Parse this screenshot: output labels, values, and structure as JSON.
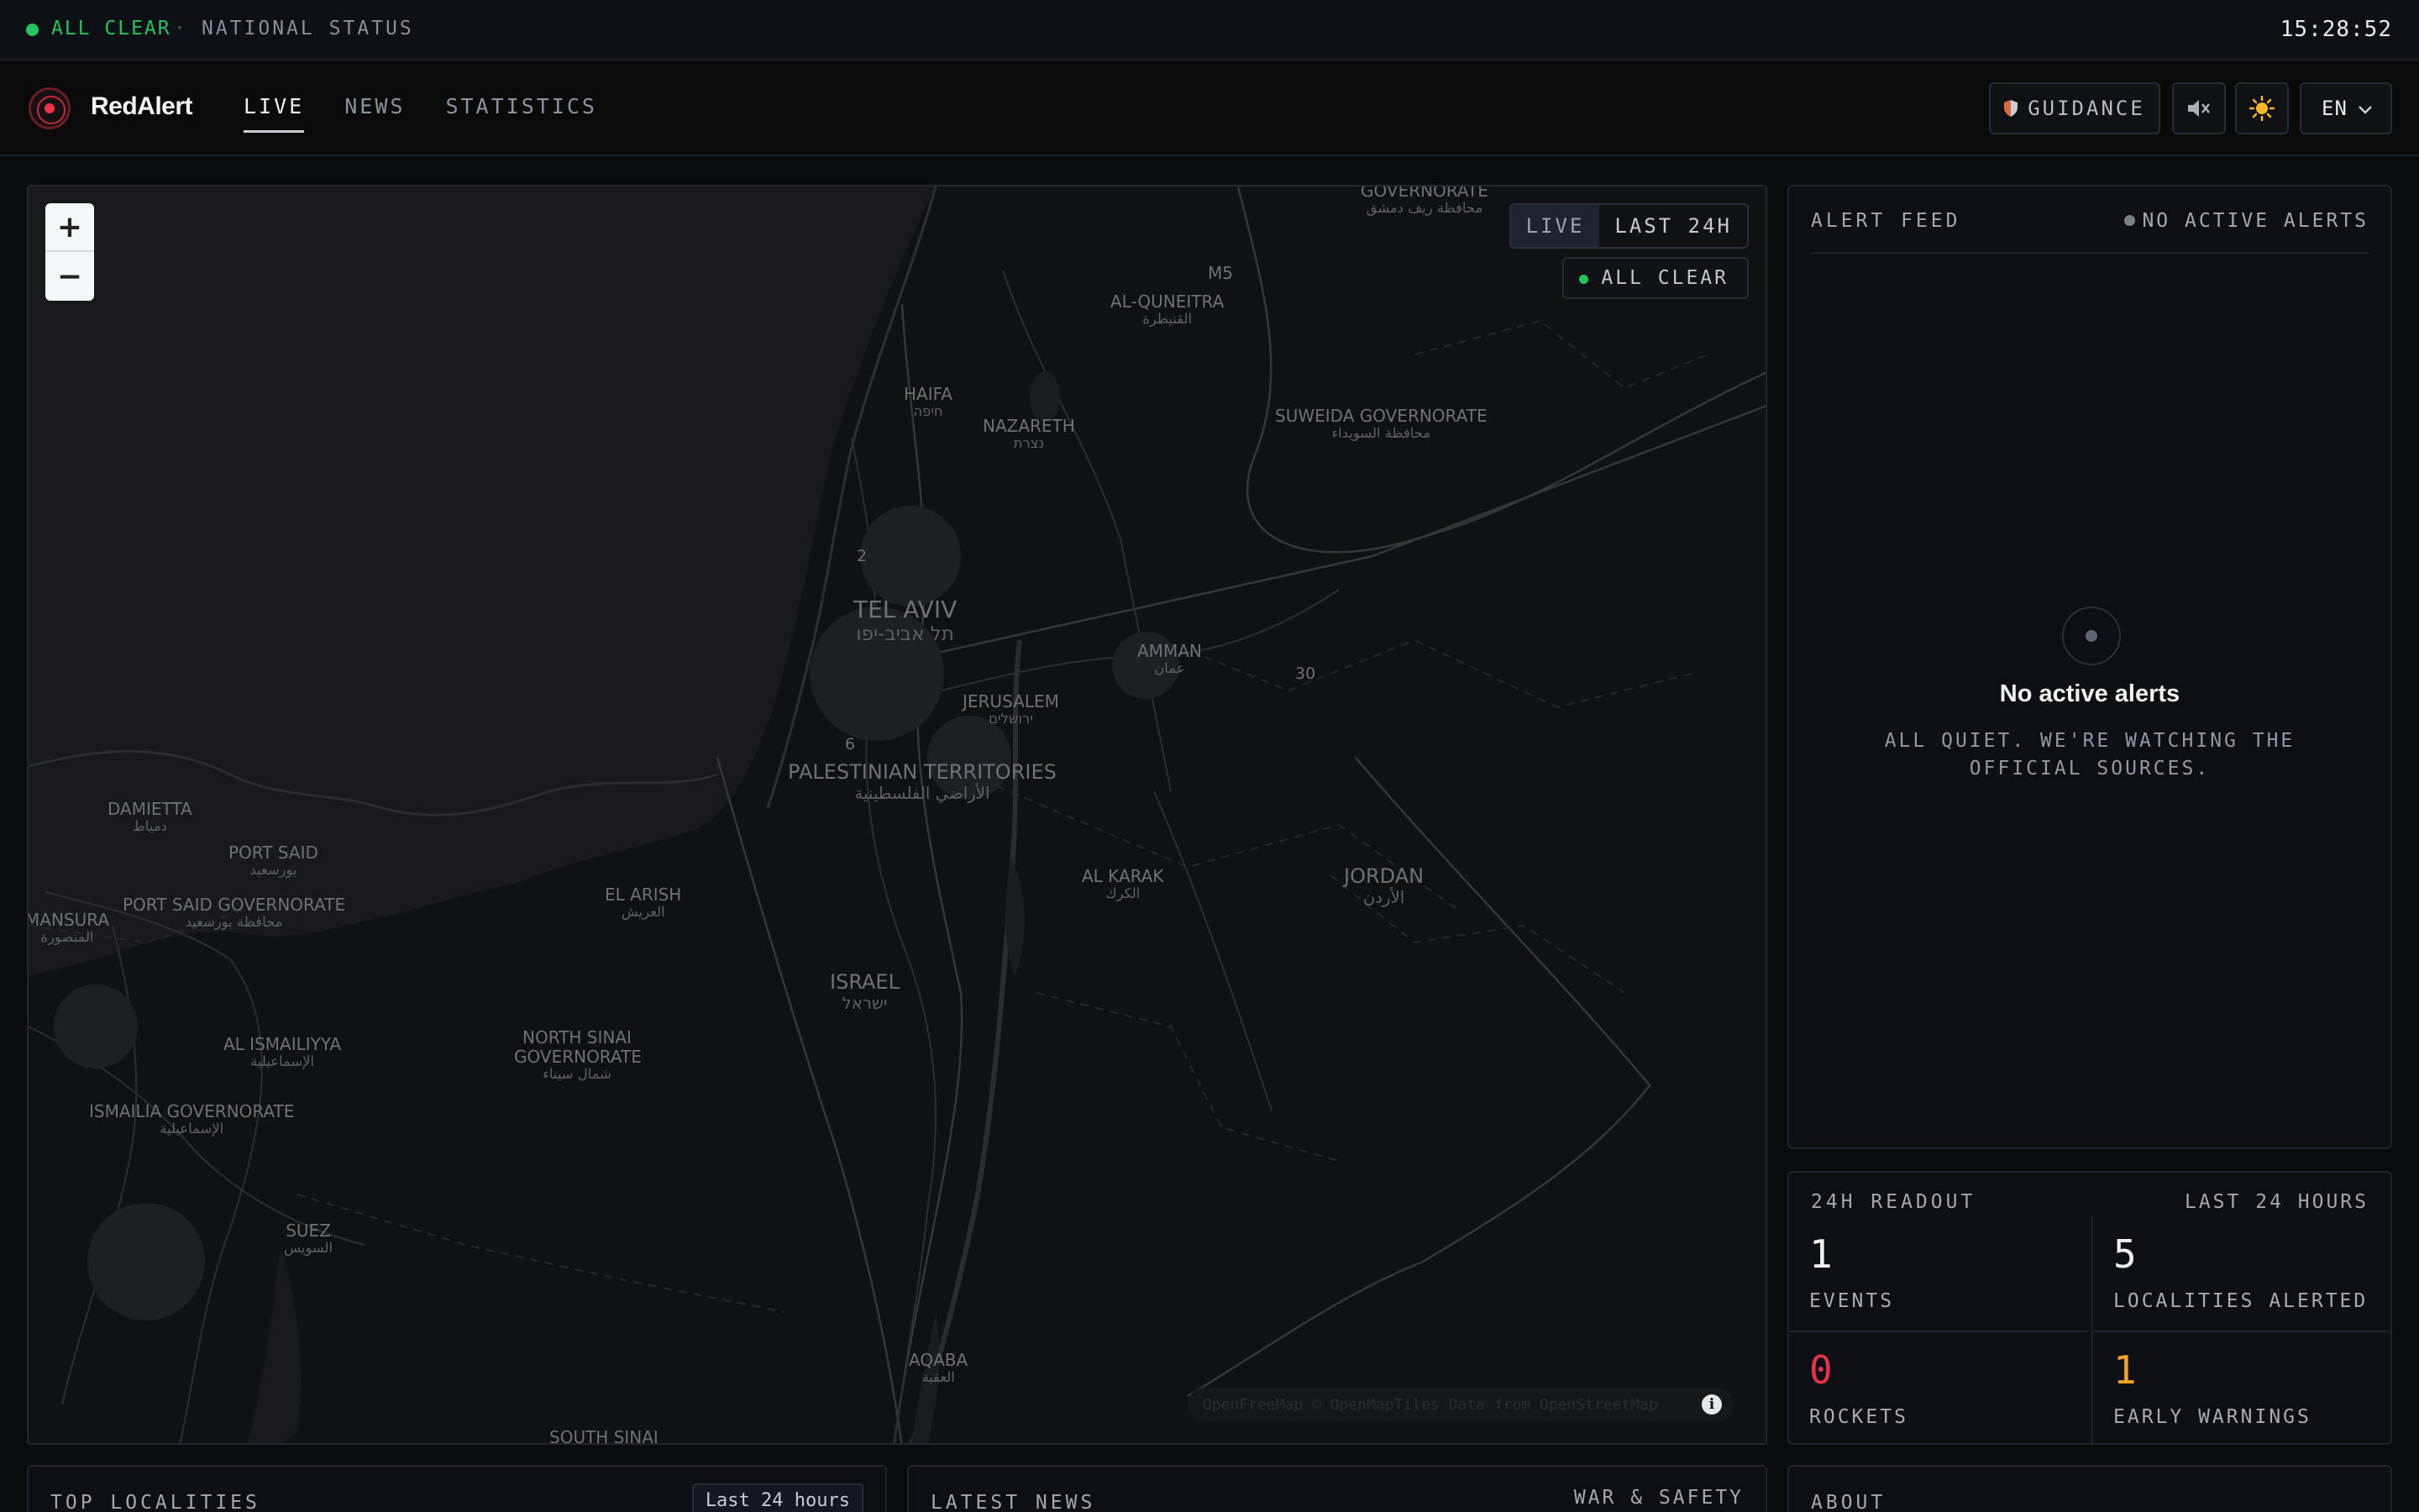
{
  "status_bar": {
    "state": "ALL CLEAR",
    "separator": "·",
    "label": "NATIONAL STATUS",
    "time": "15:28:52"
  },
  "header": {
    "brand": "RedAlert",
    "nav": [
      {
        "label": "LIVE",
        "active": true
      },
      {
        "label": "NEWS",
        "active": false
      },
      {
        "label": "STATISTICS",
        "active": false
      }
    ],
    "guidance_label": "GUIDANCE",
    "sound_icon": "speaker-muted-icon",
    "theme_icon": "sun-icon",
    "language": "EN"
  },
  "map": {
    "zoom_in": "+",
    "zoom_out": "−",
    "modes": [
      "LIVE",
      "LAST 24H"
    ],
    "active_mode": "LIVE",
    "badge": "ALL CLEAR",
    "attribution": "OpenFreeMap © OpenMapTiles Data from OpenStreetMap",
    "attribution_icon": "i",
    "labels": [
      {
        "id": "damascus-gov",
        "name": "GOVERNORATE",
        "native": "محافظة ريف دمشق"
      },
      {
        "id": "m5",
        "name": "M5",
        "native": ""
      },
      {
        "id": "quneitra",
        "name": "AL-QUNEITRA",
        "native": "القنيطرة"
      },
      {
        "id": "haifa",
        "name": "HAIFA",
        "native": "חיפה"
      },
      {
        "id": "nazareth",
        "name": "NAZARETH",
        "native": "נצרת"
      },
      {
        "id": "suweida",
        "name": "SUWEIDA GOVERNORATE",
        "native": "محافظة السويداء"
      },
      {
        "id": "tel-aviv",
        "name": "TEL AVIV",
        "native": "תל אביב-יפו"
      },
      {
        "id": "amman",
        "name": "AMMAN",
        "native": "عمان"
      },
      {
        "id": "r30",
        "name": "30",
        "native": ""
      },
      {
        "id": "jerusalem",
        "name": "JERUSALEM",
        "native": "ירושלים"
      },
      {
        "id": "r6",
        "name": "6",
        "native": ""
      },
      {
        "id": "r2",
        "name": "2",
        "native": ""
      },
      {
        "id": "palestine",
        "name": "PALESTINIAN TERRITORIES",
        "native": "الأراضي الفلسطينية"
      },
      {
        "id": "damietta",
        "name": "DAMIETTA",
        "native": "دمياط"
      },
      {
        "id": "port-said",
        "name": "PORT SAID",
        "native": "بورسعيد"
      },
      {
        "id": "port-said-gov",
        "name": "PORT SAID GOVERNORATE",
        "native": "محافظة بورسعيد"
      },
      {
        "id": "mansura",
        "name": "MANSURA",
        "native": "المنصورة"
      },
      {
        "id": "el-arish",
        "name": "EL ARISH",
        "native": "العريش"
      },
      {
        "id": "al-karak",
        "name": "AL KARAK",
        "native": "الكرك"
      },
      {
        "id": "jordan",
        "name": "JORDAN",
        "native": "الأردن"
      },
      {
        "id": "israel",
        "name": "ISRAEL",
        "native": "ישראל"
      },
      {
        "id": "north-sinai",
        "name": "NORTH SINAI GOVERNORATE",
        "native": "شمال سيناء"
      },
      {
        "id": "ismailiyya",
        "name": "AL ISMAILIYYA",
        "native": "الإسماعيلية"
      },
      {
        "id": "ismailia-gov",
        "name": "ISMAILIA GOVERNORATE",
        "native": "الإسماعيلية"
      },
      {
        "id": "suez",
        "name": "SUEZ",
        "native": "السويس"
      },
      {
        "id": "aqaba",
        "name": "AQABA",
        "native": "العقبة"
      },
      {
        "id": "south-sinai",
        "name": "SOUTH SINAI",
        "native": ""
      }
    ]
  },
  "feed": {
    "title": "ALERT FEED",
    "status": "NO ACTIVE ALERTS",
    "empty_title": "No active alerts",
    "empty_subtitle": "ALL QUIET. WE'RE WATCHING THE OFFICIAL SOURCES."
  },
  "readout": {
    "title": "24H READOUT",
    "range": "LAST 24 HOURS",
    "stats": [
      {
        "value": "1",
        "label": "EVENTS",
        "color": "#f0f1f3"
      },
      {
        "value": "5",
        "label": "LOCALITIES ALERTED",
        "color": "#f0f1f3"
      },
      {
        "value": "0",
        "label": "ROCKETS",
        "color": "#e2334a"
      },
      {
        "value": "1",
        "label": "EARLY WARNINGS",
        "color": "#f0a326"
      }
    ]
  },
  "bottom": {
    "top_localities": {
      "title": "TOP LOCALITIES",
      "filter": "Last 24 hours"
    },
    "latest_news": {
      "title": "LATEST NEWS",
      "category": "WAR & SAFETY"
    },
    "about": {
      "title": "ABOUT"
    }
  },
  "colors": {
    "accent_green": "#22c55e",
    "brand_red": "#ef3347",
    "rockets": "#e2334a",
    "early_warnings": "#f0a326"
  }
}
